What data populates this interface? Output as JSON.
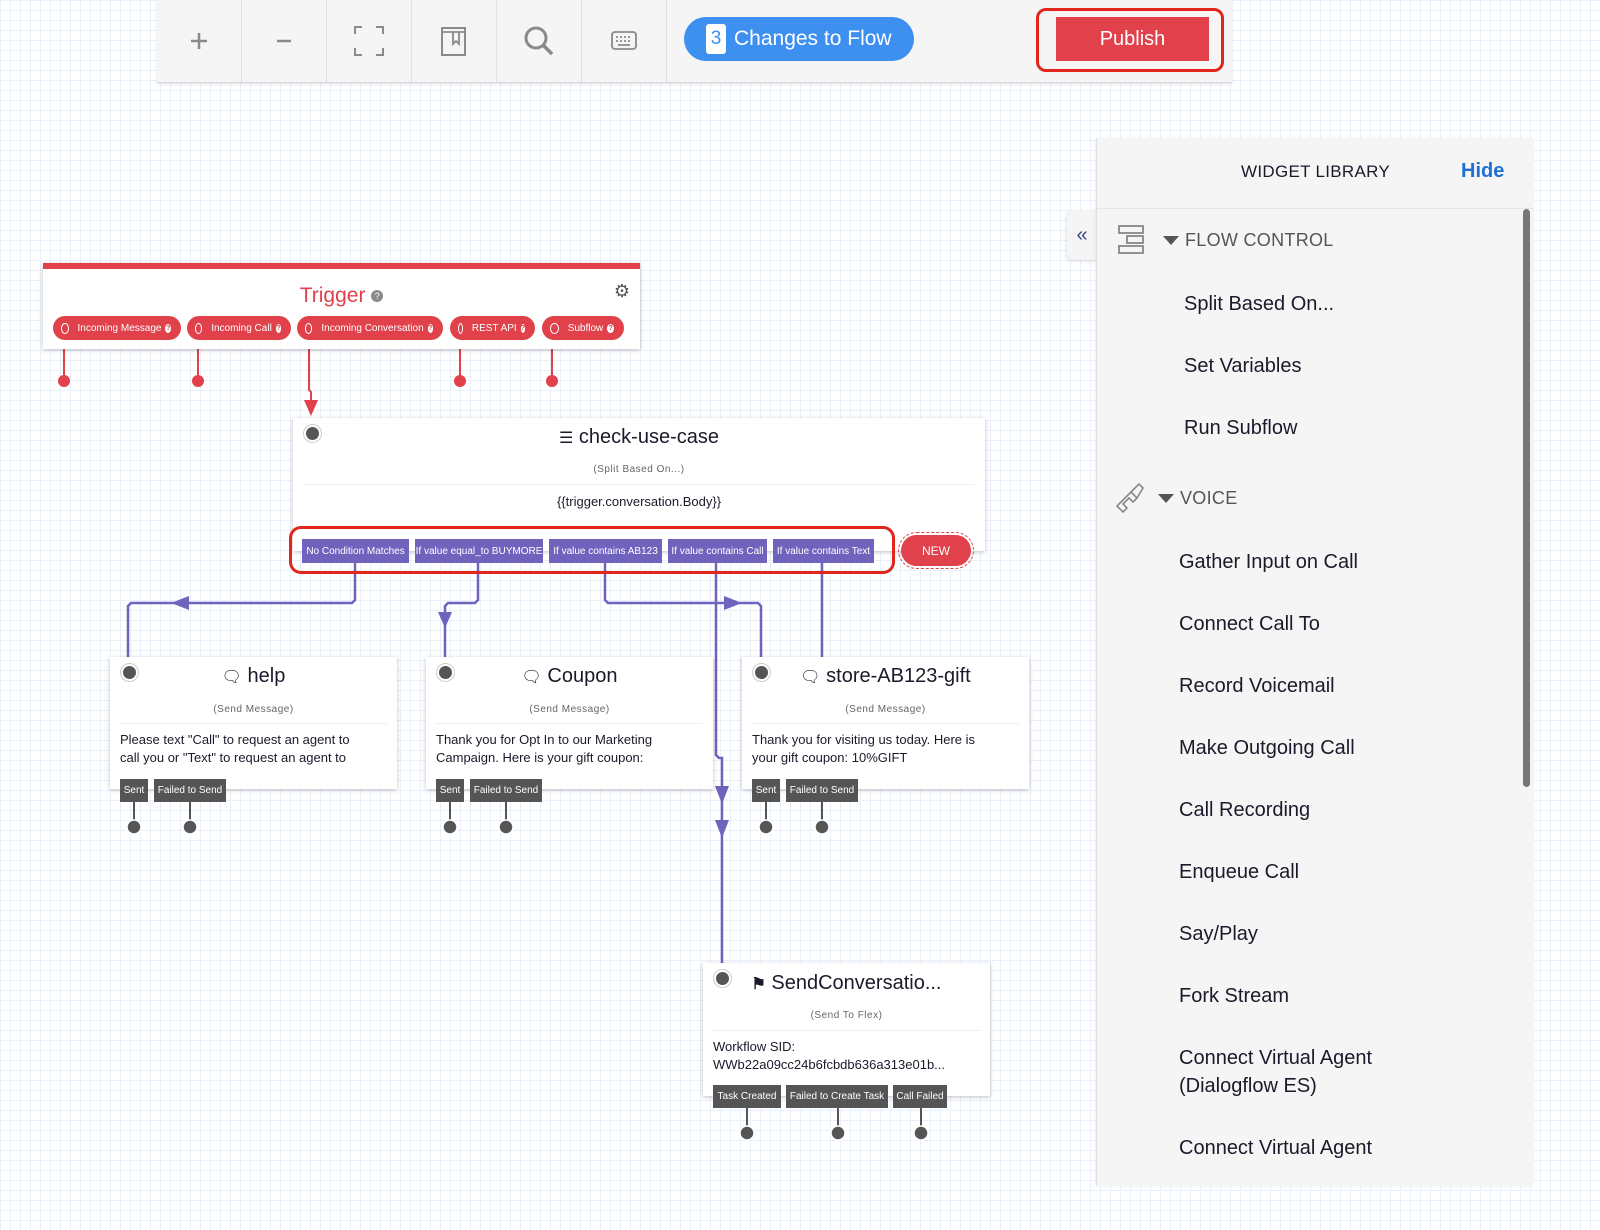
{
  "toolbar": {
    "buttons": [
      {
        "name": "zoom-in",
        "icon": "plus-icon"
      },
      {
        "name": "zoom-out",
        "icon": "minus-icon"
      },
      {
        "name": "fit-to-screen",
        "icon": "fullscreen-icon"
      },
      {
        "name": "notes",
        "icon": "bookmark-book-icon"
      },
      {
        "name": "search",
        "icon": "search-icon"
      },
      {
        "name": "keyboard-shortcuts",
        "icon": "keyboard-icon"
      }
    ],
    "changes_count": "3",
    "changes_label": "Changes to Flow",
    "publish_label": "Publish"
  },
  "trigger": {
    "title": "Trigger",
    "help": "?",
    "pills": [
      {
        "label": "Incoming Message"
      },
      {
        "label": "Incoming Call"
      },
      {
        "label": "Incoming Conversation"
      },
      {
        "label": "REST API"
      },
      {
        "label": "Subflow"
      }
    ]
  },
  "split_node": {
    "title": "check-use-case",
    "type": "(Split Based On...)",
    "body": "{{trigger.conversation.Body}}",
    "conditions": [
      "No Condition Matches",
      "If value equal_to BUYMORE",
      "If value contains AB123",
      "If value contains Call",
      "If value contains Text"
    ],
    "new_label": "NEW"
  },
  "message_nodes": [
    {
      "title": "help",
      "type": "(Send Message)",
      "body_line1": "Please text \"Call\" to request an agent to",
      "body_line2": "call you or \"Text\" to request an agent to",
      "transitions": [
        "Sent",
        "Failed to Send"
      ]
    },
    {
      "title": "Coupon",
      "type": "(Send Message)",
      "body_line1": "Thank you for Opt In to our Marketing",
      "body_line2": "Campaign. Here is your gift coupon:",
      "transitions": [
        "Sent",
        "Failed to Send"
      ]
    },
    {
      "title": "store-AB123-gift",
      "type": "(Send Message)",
      "body_line1": "Thank you for visiting us today. Here is",
      "body_line2": "your gift coupon: 10%GIFT",
      "transitions": [
        "Sent",
        "Failed to Send"
      ]
    }
  ],
  "flex_node": {
    "title": "SendConversatio...",
    "type": "(Send To Flex)",
    "body_line1": "Workflow SID:",
    "body_line2": "WWb22a09cc24b6fcbdb636a313e01b...",
    "transitions": [
      "Task Created",
      "Failed to Create Task",
      "Call Failed"
    ]
  },
  "library": {
    "title": "WIDGET LIBRARY",
    "hide_label": "Hide",
    "categories": [
      {
        "label": "FLOW CONTROL",
        "icon": "split-icon",
        "items": [
          "Split Based On...",
          "Set Variables",
          "Run Subflow"
        ]
      },
      {
        "label": "VOICE",
        "icon": "phone-icon",
        "items": [
          "Gather Input on Call",
          "Connect Call To",
          "Record Voicemail",
          "Make Outgoing Call",
          "Call Recording",
          "Enqueue Call",
          "Say/Play",
          "Fork Stream",
          "Connect Virtual Agent",
          "(Dialogflow ES)",
          "Connect Virtual Agent"
        ]
      }
    ]
  },
  "colors": {
    "accent_red": "#e0414b",
    "highlight_red": "#e1261c",
    "condition_purple": "#6f63bd",
    "primary_blue": "#3d8ff0",
    "link_blue": "#1f6fd6"
  }
}
